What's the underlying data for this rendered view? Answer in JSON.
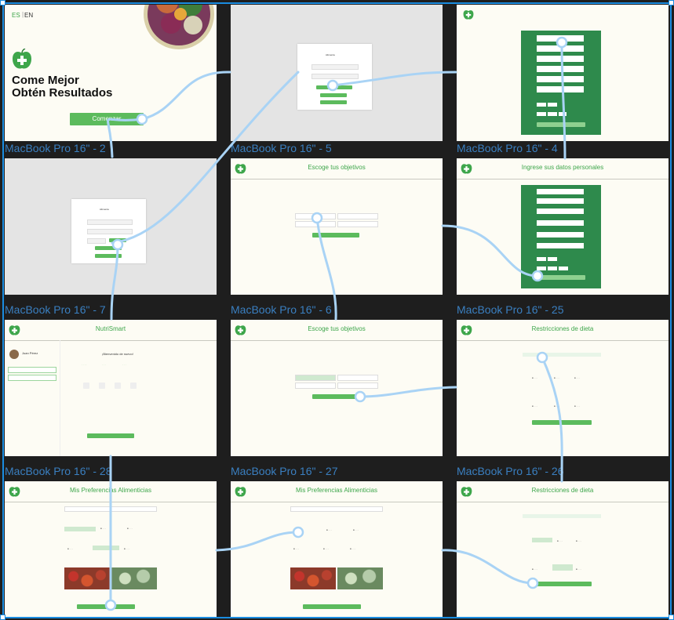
{
  "frames": {
    "f2": {
      "label": "MacBook Pro 16\" - 2",
      "lang_es": "ES",
      "lang_en": "EN",
      "headline1": "Come Mejor",
      "headline2": "Obtén Resultados",
      "cta": "Comenzar"
    },
    "f5": {
      "label": "MacBook Pro 16\" - 5"
    },
    "f4": {
      "label": "MacBook Pro 16\" - 4"
    },
    "f7": {
      "label": "MacBook Pro 16\" - 7"
    },
    "f6": {
      "label": "MacBook Pro 16\" - 6",
      "title": "Escoge tus objetivos"
    },
    "f25": {
      "label": "MacBook Pro 16\" - 25",
      "title": "Ingrese sus datos personales"
    },
    "f28": {
      "label": "MacBook Pro 16\" - 28",
      "title": "NutriSmart",
      "user": "Juan Pérez",
      "welcome": "¡Bienvenido de nuevo!"
    },
    "f27": {
      "label": "MacBook Pro 16\" - 27",
      "title": "Escoge tus objetivos"
    },
    "f26": {
      "label": "MacBook Pro 16\" - 26",
      "title": "Restricciones de dieta"
    },
    "f29": {
      "title": "Mis Preferencias Alimenticias"
    },
    "f30": {
      "title": "Mis Preferencias Alimenticias"
    },
    "f31": {
      "title": "Restricciones de dieta"
    }
  },
  "colors": {
    "brand_green": "#3ea64b",
    "button_green": "#5cbb5d",
    "form_green": "#2e8a4c",
    "selection_blue": "#1a8ce0",
    "connector_blue": "#a9d3f5"
  },
  "icons": {
    "logo": "apple-plus-icon"
  }
}
